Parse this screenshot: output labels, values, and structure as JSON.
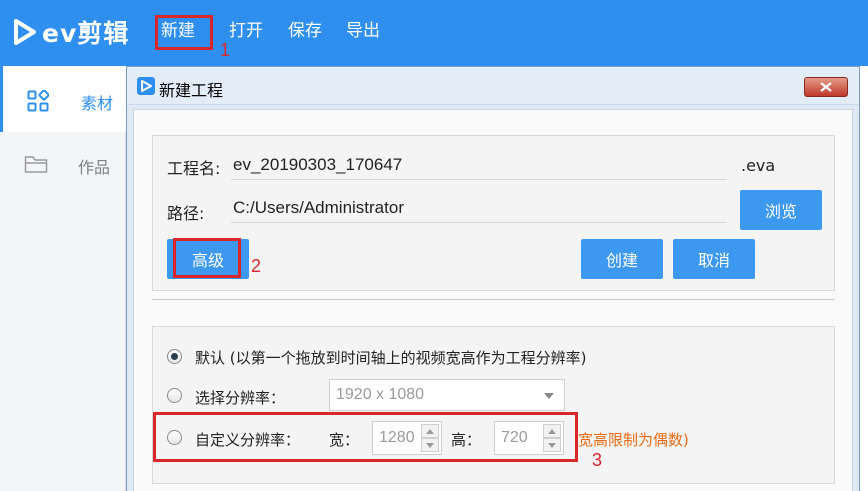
{
  "app": {
    "logo_text": "ev剪辑",
    "menu": {
      "new": "新建",
      "open": "打开",
      "save": "保存",
      "export": "导出"
    },
    "accent_color": "#2f8fef"
  },
  "sidebar": {
    "items": [
      {
        "label": "素材",
        "icon": "grid-icon",
        "active": true
      },
      {
        "label": "作品",
        "icon": "folder-icon",
        "active": false
      }
    ]
  },
  "dialog": {
    "title": "新建工程",
    "project_name_label": "工程名:",
    "project_name_value": "ev_20190303_170647",
    "extension": ".eva",
    "path_label": "路径:",
    "path_value": "C:/Users/Administrator",
    "browse_button": "浏览",
    "advanced_button": "高级",
    "create_button": "创建",
    "cancel_button": "取消",
    "options": {
      "default_label": "默认 (以第一个拖放到时间轴上的视频宽高作为工程分辨率)",
      "select_label": "选择分辨率：",
      "select_value": "1920 x 1080",
      "custom_label": "自定义分辨率：",
      "width_label": "宽：",
      "width_value": "1280",
      "height_label": "高：",
      "height_value": "720",
      "note": "宽高限制为偶数)",
      "selected": "default"
    }
  },
  "annotations": {
    "step1": "1",
    "step2": "2",
    "step3": "3",
    "mark_color": "#d9262b"
  }
}
